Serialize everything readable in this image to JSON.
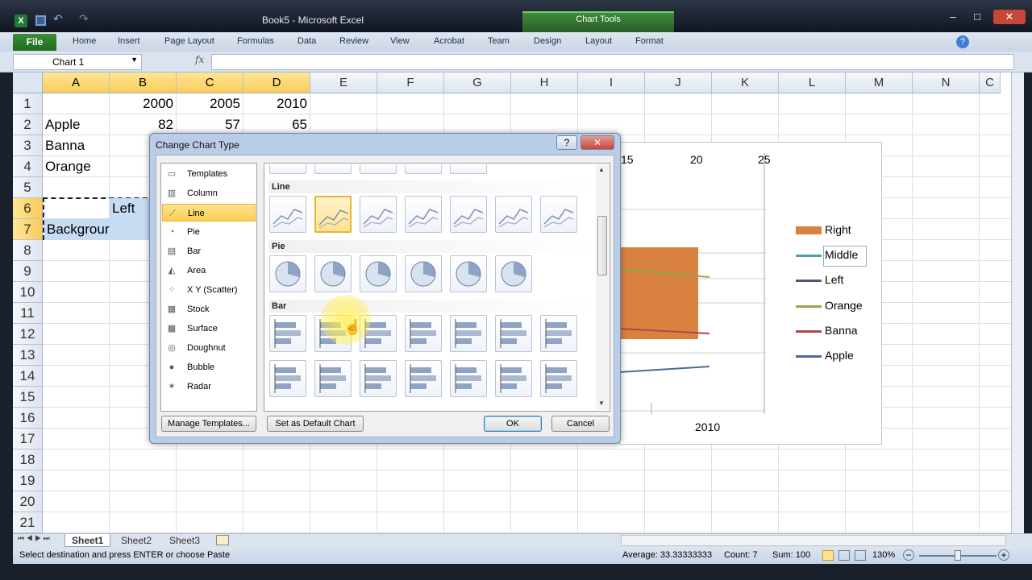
{
  "window": {
    "title": "Book5 - Microsoft Excel",
    "context_tab_group": "Chart Tools"
  },
  "ribbon": {
    "file": "File",
    "tabs": [
      "Home",
      "Insert",
      "Page Layout",
      "Formulas",
      "Data",
      "Review",
      "View",
      "Acrobat",
      "Team",
      "Design",
      "Layout",
      "Format"
    ]
  },
  "formula_bar": {
    "name_box": "Chart 1",
    "fx": "fx",
    "formula": ""
  },
  "columns": [
    "A",
    "B",
    "C",
    "D",
    "E",
    "F",
    "G",
    "H",
    "I",
    "J",
    "K",
    "L",
    "M",
    "N",
    "C"
  ],
  "selected_columns": [
    "A",
    "B",
    "C",
    "D"
  ],
  "rows": [
    "1",
    "2",
    "3",
    "4",
    "5",
    "6",
    "7",
    "8",
    "9",
    "10",
    "11",
    "12",
    "13",
    "14",
    "15",
    "16",
    "17",
    "18",
    "19",
    "20",
    "21"
  ],
  "cells": {
    "B1": "2000",
    "C1": "2005",
    "D1": "2010",
    "A2": "Apple",
    "B2": "82",
    "C2": "57",
    "D2": "65",
    "A3": "Banna",
    "A4": "Orange",
    "B6": "Left",
    "A7": "Backgrour"
  },
  "chart": {
    "axis_ticks": [
      "15",
      "20",
      "25"
    ],
    "category_label": "2010",
    "legend": [
      {
        "label": "Right",
        "color": "#d9823f",
        "kind": "bar"
      },
      {
        "label": "Middle",
        "color": "#4a9fa8",
        "kind": "line"
      },
      {
        "label": "Left",
        "color": "#5b4f7e",
        "kind": "line"
      },
      {
        "label": "Orange",
        "color": "#8faa4a",
        "kind": "line"
      },
      {
        "label": "Banna",
        "color": "#b04848",
        "kind": "line"
      },
      {
        "label": "Apple",
        "color": "#4a6a9c",
        "kind": "line"
      }
    ]
  },
  "dialog": {
    "title": "Change Chart Type",
    "help": "?",
    "close": "✕",
    "categories": [
      "Templates",
      "Column",
      "Line",
      "Pie",
      "Bar",
      "Area",
      "X Y (Scatter)",
      "Stock",
      "Surface",
      "Doughnut",
      "Bubble",
      "Radar"
    ],
    "selected_category": "Line",
    "sections": [
      "Line",
      "Pie",
      "Bar"
    ],
    "buttons": {
      "manage": "Manage Templates...",
      "set_default": "Set as Default Chart",
      "ok": "OK",
      "cancel": "Cancel"
    }
  },
  "sheets": [
    "Sheet1",
    "Sheet2",
    "Sheet3"
  ],
  "active_sheet": "Sheet1",
  "status": {
    "message": "Select destination and press ENTER or choose Paste",
    "average": "Average: 33.33333333",
    "count": "Count: 7",
    "sum": "Sum: 100",
    "zoom": "130%"
  }
}
